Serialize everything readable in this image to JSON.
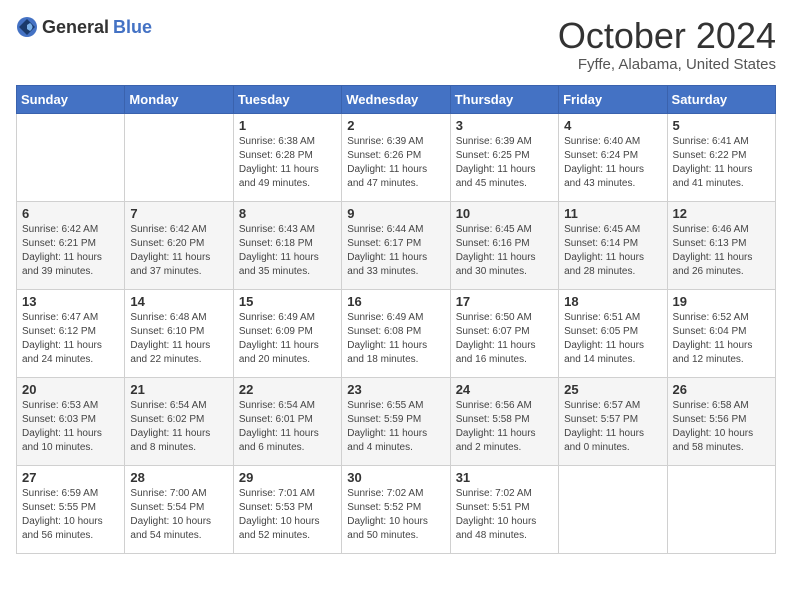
{
  "header": {
    "logo_general": "General",
    "logo_blue": "Blue",
    "month_title": "October 2024",
    "location": "Fyffe, Alabama, United States"
  },
  "weekdays": [
    "Sunday",
    "Monday",
    "Tuesday",
    "Wednesday",
    "Thursday",
    "Friday",
    "Saturday"
  ],
  "weeks": [
    [
      {
        "day": null,
        "sunrise": null,
        "sunset": null,
        "daylight": null
      },
      {
        "day": null,
        "sunrise": null,
        "sunset": null,
        "daylight": null
      },
      {
        "day": "1",
        "sunrise": "Sunrise: 6:38 AM",
        "sunset": "Sunset: 6:28 PM",
        "daylight": "Daylight: 11 hours and 49 minutes."
      },
      {
        "day": "2",
        "sunrise": "Sunrise: 6:39 AM",
        "sunset": "Sunset: 6:26 PM",
        "daylight": "Daylight: 11 hours and 47 minutes."
      },
      {
        "day": "3",
        "sunrise": "Sunrise: 6:39 AM",
        "sunset": "Sunset: 6:25 PM",
        "daylight": "Daylight: 11 hours and 45 minutes."
      },
      {
        "day": "4",
        "sunrise": "Sunrise: 6:40 AM",
        "sunset": "Sunset: 6:24 PM",
        "daylight": "Daylight: 11 hours and 43 minutes."
      },
      {
        "day": "5",
        "sunrise": "Sunrise: 6:41 AM",
        "sunset": "Sunset: 6:22 PM",
        "daylight": "Daylight: 11 hours and 41 minutes."
      }
    ],
    [
      {
        "day": "6",
        "sunrise": "Sunrise: 6:42 AM",
        "sunset": "Sunset: 6:21 PM",
        "daylight": "Daylight: 11 hours and 39 minutes."
      },
      {
        "day": "7",
        "sunrise": "Sunrise: 6:42 AM",
        "sunset": "Sunset: 6:20 PM",
        "daylight": "Daylight: 11 hours and 37 minutes."
      },
      {
        "day": "8",
        "sunrise": "Sunrise: 6:43 AM",
        "sunset": "Sunset: 6:18 PM",
        "daylight": "Daylight: 11 hours and 35 minutes."
      },
      {
        "day": "9",
        "sunrise": "Sunrise: 6:44 AM",
        "sunset": "Sunset: 6:17 PM",
        "daylight": "Daylight: 11 hours and 33 minutes."
      },
      {
        "day": "10",
        "sunrise": "Sunrise: 6:45 AM",
        "sunset": "Sunset: 6:16 PM",
        "daylight": "Daylight: 11 hours and 30 minutes."
      },
      {
        "day": "11",
        "sunrise": "Sunrise: 6:45 AM",
        "sunset": "Sunset: 6:14 PM",
        "daylight": "Daylight: 11 hours and 28 minutes."
      },
      {
        "day": "12",
        "sunrise": "Sunrise: 6:46 AM",
        "sunset": "Sunset: 6:13 PM",
        "daylight": "Daylight: 11 hours and 26 minutes."
      }
    ],
    [
      {
        "day": "13",
        "sunrise": "Sunrise: 6:47 AM",
        "sunset": "Sunset: 6:12 PM",
        "daylight": "Daylight: 11 hours and 24 minutes."
      },
      {
        "day": "14",
        "sunrise": "Sunrise: 6:48 AM",
        "sunset": "Sunset: 6:10 PM",
        "daylight": "Daylight: 11 hours and 22 minutes."
      },
      {
        "day": "15",
        "sunrise": "Sunrise: 6:49 AM",
        "sunset": "Sunset: 6:09 PM",
        "daylight": "Daylight: 11 hours and 20 minutes."
      },
      {
        "day": "16",
        "sunrise": "Sunrise: 6:49 AM",
        "sunset": "Sunset: 6:08 PM",
        "daylight": "Daylight: 11 hours and 18 minutes."
      },
      {
        "day": "17",
        "sunrise": "Sunrise: 6:50 AM",
        "sunset": "Sunset: 6:07 PM",
        "daylight": "Daylight: 11 hours and 16 minutes."
      },
      {
        "day": "18",
        "sunrise": "Sunrise: 6:51 AM",
        "sunset": "Sunset: 6:05 PM",
        "daylight": "Daylight: 11 hours and 14 minutes."
      },
      {
        "day": "19",
        "sunrise": "Sunrise: 6:52 AM",
        "sunset": "Sunset: 6:04 PM",
        "daylight": "Daylight: 11 hours and 12 minutes."
      }
    ],
    [
      {
        "day": "20",
        "sunrise": "Sunrise: 6:53 AM",
        "sunset": "Sunset: 6:03 PM",
        "daylight": "Daylight: 11 hours and 10 minutes."
      },
      {
        "day": "21",
        "sunrise": "Sunrise: 6:54 AM",
        "sunset": "Sunset: 6:02 PM",
        "daylight": "Daylight: 11 hours and 8 minutes."
      },
      {
        "day": "22",
        "sunrise": "Sunrise: 6:54 AM",
        "sunset": "Sunset: 6:01 PM",
        "daylight": "Daylight: 11 hours and 6 minutes."
      },
      {
        "day": "23",
        "sunrise": "Sunrise: 6:55 AM",
        "sunset": "Sunset: 5:59 PM",
        "daylight": "Daylight: 11 hours and 4 minutes."
      },
      {
        "day": "24",
        "sunrise": "Sunrise: 6:56 AM",
        "sunset": "Sunset: 5:58 PM",
        "daylight": "Daylight: 11 hours and 2 minutes."
      },
      {
        "day": "25",
        "sunrise": "Sunrise: 6:57 AM",
        "sunset": "Sunset: 5:57 PM",
        "daylight": "Daylight: 11 hours and 0 minutes."
      },
      {
        "day": "26",
        "sunrise": "Sunrise: 6:58 AM",
        "sunset": "Sunset: 5:56 PM",
        "daylight": "Daylight: 10 hours and 58 minutes."
      }
    ],
    [
      {
        "day": "27",
        "sunrise": "Sunrise: 6:59 AM",
        "sunset": "Sunset: 5:55 PM",
        "daylight": "Daylight: 10 hours and 56 minutes."
      },
      {
        "day": "28",
        "sunrise": "Sunrise: 7:00 AM",
        "sunset": "Sunset: 5:54 PM",
        "daylight": "Daylight: 10 hours and 54 minutes."
      },
      {
        "day": "29",
        "sunrise": "Sunrise: 7:01 AM",
        "sunset": "Sunset: 5:53 PM",
        "daylight": "Daylight: 10 hours and 52 minutes."
      },
      {
        "day": "30",
        "sunrise": "Sunrise: 7:02 AM",
        "sunset": "Sunset: 5:52 PM",
        "daylight": "Daylight: 10 hours and 50 minutes."
      },
      {
        "day": "31",
        "sunrise": "Sunrise: 7:02 AM",
        "sunset": "Sunset: 5:51 PM",
        "daylight": "Daylight: 10 hours and 48 minutes."
      },
      {
        "day": null,
        "sunrise": null,
        "sunset": null,
        "daylight": null
      },
      {
        "day": null,
        "sunrise": null,
        "sunset": null,
        "daylight": null
      }
    ]
  ]
}
